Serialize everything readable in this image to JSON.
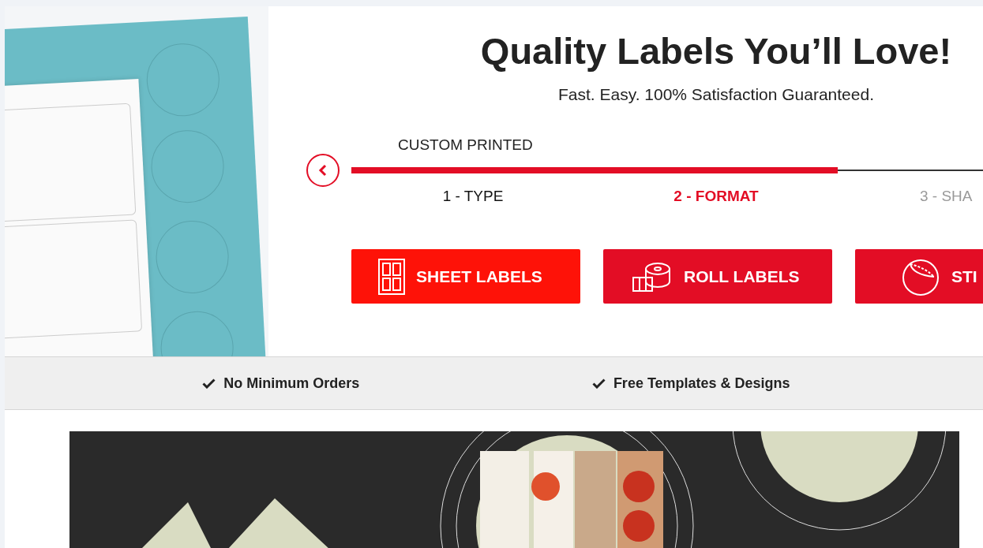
{
  "headline": "Quality Labels You’ll Love!",
  "subtitle": "Fast. Easy. 100% Satisfaction Guaranteed.",
  "stepper": {
    "category": "CUSTOM PRINTED",
    "level": 0.77,
    "steps": [
      {
        "label": "1 - TYPE",
        "completed": true,
        "selected": false
      },
      {
        "label": "2 - FORMAT",
        "completed": false,
        "selected": true
      },
      {
        "label": "3 - SHA",
        "completed": false,
        "selected": false
      }
    ]
  },
  "format_buttons": [
    {
      "label": "SHEET LABELS",
      "kind": "sheet"
    },
    {
      "label": "ROLL LABELS",
      "kind": "roll"
    },
    {
      "label": "STI",
      "kind": "sticker"
    }
  ],
  "features": [
    {
      "label": "No Minimum Orders"
    },
    {
      "label": "Free Templates & Designs"
    }
  ]
}
